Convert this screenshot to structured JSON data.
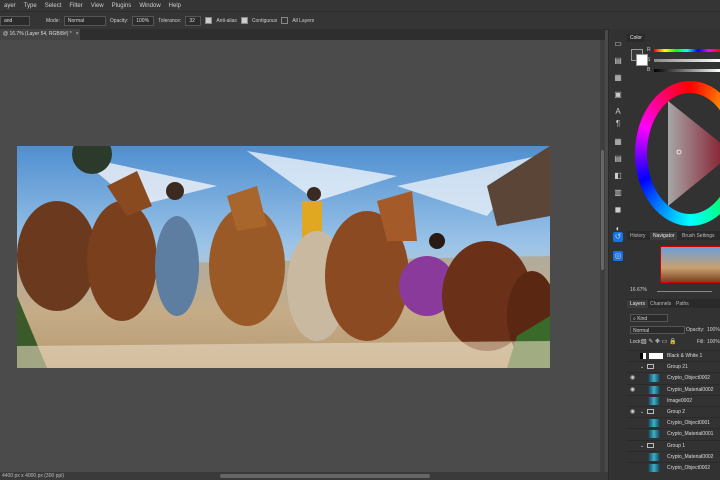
{
  "menu": [
    "ayer",
    "Type",
    "Select",
    "Filter",
    "View",
    "Plugins",
    "Window",
    "Help"
  ],
  "options": {
    "tool_value": "and",
    "mode_label": "Mode:",
    "mode_value": "Normal",
    "opacity_label": "Opacity:",
    "opacity_value": "100%",
    "tolerance_label": "Tolerance:",
    "tolerance_value": "32",
    "antialias_label": "Anti-alias",
    "contiguous_label": "Contiguous",
    "all_layers_label": "All Layers"
  },
  "document_tab": "@ 16.7% (Layer 54, RGB/8#) *",
  "status": "4400 px x 4000 px (300 ppi)",
  "color_panel": {
    "tab": "Color",
    "r": "R",
    "s": "S",
    "b": "B"
  },
  "navigator": {
    "tabs": [
      "History",
      "Navigator",
      "Brush Settings"
    ],
    "zoom": "16.67%"
  },
  "layers_panel": {
    "tabs": [
      "Layers",
      "Channels",
      "Paths"
    ],
    "kind_label": "Kind",
    "blend_mode": "Normal",
    "opacity_label": "Opacity:",
    "opacity_value": "100%",
    "lock_label": "Lock:",
    "fill_label": "Fill:",
    "fill_value": "100%",
    "layers": [
      {
        "name": "Black & White 1",
        "type": "adjustment"
      },
      {
        "name": "Group 21",
        "type": "group"
      },
      {
        "name": "Crypto_Object0002",
        "type": "layer"
      },
      {
        "name": "Crypto_Material0002",
        "type": "layer"
      },
      {
        "name": "Image0002",
        "type": "layer"
      },
      {
        "name": "Group 2",
        "type": "group"
      },
      {
        "name": "Crypto_Object0001",
        "type": "layer"
      },
      {
        "name": "Crypto_Material0001",
        "type": "layer"
      },
      {
        "name": "Group 1",
        "type": "group"
      },
      {
        "name": "Crypto_Material0002",
        "type": "layer"
      },
      {
        "name": "Crypto_Object0002",
        "type": "layer"
      }
    ]
  },
  "colors": {
    "accent": "#1473e6",
    "panel": "#323232",
    "canvas": "#4b4b4b"
  }
}
